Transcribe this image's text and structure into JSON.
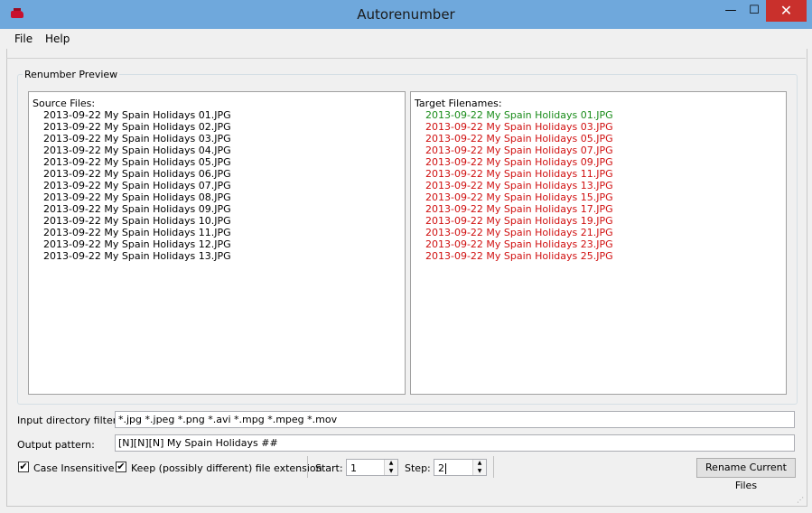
{
  "window": {
    "title": "Autorenumber",
    "min_label": "—",
    "max_label": "☐",
    "close_label": "✕"
  },
  "menu": {
    "file": "File",
    "help": "Help"
  },
  "preview": {
    "group_label": "Renumber Preview",
    "source_header": "Source Files:",
    "target_header": "Target Filenames:",
    "source_files": [
      "2013-09-22 My Spain Holidays 01.JPG",
      "2013-09-22 My Spain Holidays 02.JPG",
      "2013-09-22 My Spain Holidays 03.JPG",
      "2013-09-22 My Spain Holidays 04.JPG",
      "2013-09-22 My Spain Holidays 05.JPG",
      "2013-09-22 My Spain Holidays 06.JPG",
      "2013-09-22 My Spain Holidays 07.JPG",
      "2013-09-22 My Spain Holidays 08.JPG",
      "2013-09-22 My Spain Holidays 09.JPG",
      "2013-09-22 My Spain Holidays 10.JPG",
      "2013-09-22 My Spain Holidays 11.JPG",
      "2013-09-22 My Spain Holidays 12.JPG",
      "2013-09-22 My Spain Holidays 13.JPG"
    ],
    "target_files": [
      {
        "name": "2013-09-22 My Spain Holidays 01.JPG",
        "color": "#1a8c1a"
      },
      {
        "name": "2013-09-22 My Spain Holidays 03.JPG",
        "color": "#d01010"
      },
      {
        "name": "2013-09-22 My Spain Holidays 05.JPG",
        "color": "#d01010"
      },
      {
        "name": "2013-09-22 My Spain Holidays 07.JPG",
        "color": "#d01010"
      },
      {
        "name": "2013-09-22 My Spain Holidays 09.JPG",
        "color": "#d01010"
      },
      {
        "name": "2013-09-22 My Spain Holidays 11.JPG",
        "color": "#d01010"
      },
      {
        "name": "2013-09-22 My Spain Holidays 13.JPG",
        "color": "#d01010"
      },
      {
        "name": "2013-09-22 My Spain Holidays 15.JPG",
        "color": "#d01010"
      },
      {
        "name": "2013-09-22 My Spain Holidays 17.JPG",
        "color": "#d01010"
      },
      {
        "name": "2013-09-22 My Spain Holidays 19.JPG",
        "color": "#d01010"
      },
      {
        "name": "2013-09-22 My Spain Holidays 21.JPG",
        "color": "#d01010"
      },
      {
        "name": "2013-09-22 My Spain Holidays 23.JPG",
        "color": "#d01010"
      },
      {
        "name": "2013-09-22 My Spain Holidays 25.JPG",
        "color": "#d01010"
      }
    ]
  },
  "form": {
    "filter_label": "Input directory filter:",
    "filter_value": "*.jpg *.jpeg *.png *.avi *.mpg *.mpeg *.mov",
    "pattern_label": "Output pattern:",
    "pattern_value": "[N][N][N] My Spain Holidays ##",
    "case_insensitive_label": "Case Insensitive",
    "case_insensitive_checked": true,
    "keep_ext_label": "Keep (possibly different) file extension",
    "keep_ext_checked": true,
    "start_label": "Start:",
    "start_value": "1",
    "step_label": "Step:",
    "step_value": "2",
    "rename_button": "Rename Current Files"
  },
  "icons": {
    "check": "✔",
    "spin_up": "▲",
    "spin_down": "▼",
    "grip": "⋰"
  }
}
